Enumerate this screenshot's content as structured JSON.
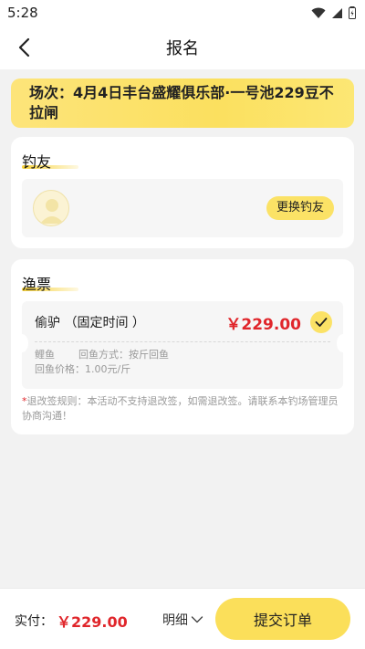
{
  "status_bar": {
    "time": "5:28"
  },
  "nav": {
    "title": "报名"
  },
  "session": {
    "label": "场次：",
    "text": "4月4日丰台盛耀俱乐部·一号池229豆不拉闸"
  },
  "angler_section": {
    "title": "钓友",
    "change_label": "更换钓友"
  },
  "ticket_section": {
    "title": "渔票",
    "ticket": {
      "name": "偷驴 （固定时间 ）",
      "price": "￥229.00",
      "fish": "鲤鱼",
      "return_method": "回鱼方式：按斤回鱼",
      "return_price": "回鱼价格：1.00元/斤",
      "selected": true
    },
    "refund_note": "退改签规则：本活动不支持退改签，如需退改签。请联系本钓场管理员协商沟通！"
  },
  "bottom": {
    "pay_label": "实付：",
    "pay_amount": "￥229.00",
    "detail_label": "明细",
    "submit_label": "提交订单"
  },
  "colors": {
    "accent_yellow": "#fbe266",
    "price_red": "#e0262b"
  }
}
